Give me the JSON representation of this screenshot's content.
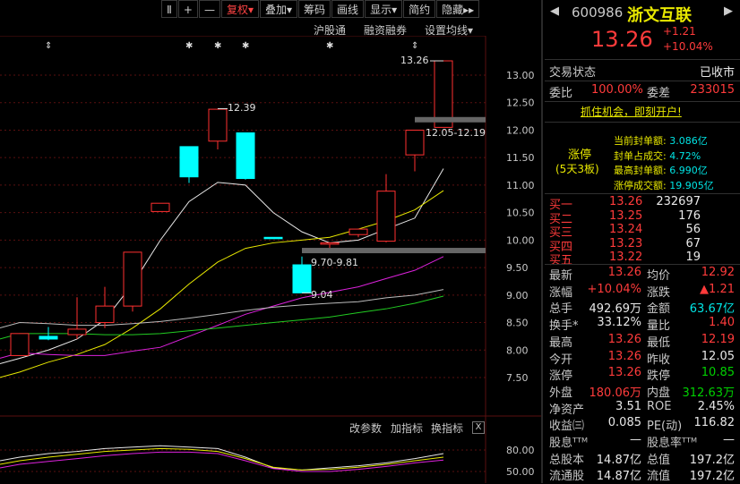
{
  "toolbar": {
    "items": [
      "Ⅱ",
      "+",
      "—",
      "复权▾",
      "叠加▾",
      "筹码",
      "画线",
      "显示▾",
      "简约",
      "隐藏▸▸"
    ]
  },
  "subbar": {
    "hk": "沪股通",
    "margin": "融资融券",
    "ma_settings": "设置均线▾"
  },
  "stock": {
    "code": "600986",
    "name": "浙文互联",
    "price": "13.26",
    "change": "+1.21",
    "pct": "+10.04%"
  },
  "trade_status": {
    "label": "交易状态",
    "value": "已收市"
  },
  "weibi": {
    "label": "委比",
    "value": "100.00%",
    "label2": "委差",
    "value2": "233015"
  },
  "banner": "抓住机会，即刻开户!",
  "limit_up": {
    "tag": "涨停",
    "sub": "(5天3板)",
    "rows": [
      {
        "label": "当前封单额:",
        "value": "3.086亿"
      },
      {
        "label": "封单占成交:",
        "value": "4.72%"
      },
      {
        "label": "最高封单额:",
        "value": "6.990亿"
      },
      {
        "label": "涨停成交额:",
        "value": "19.905亿"
      }
    ]
  },
  "order_book": [
    {
      "label": "买一",
      "price": "13.26",
      "vol": "232697"
    },
    {
      "label": "买二",
      "price": "13.25",
      "vol": "176"
    },
    {
      "label": "买三",
      "price": "13.24",
      "vol": "56"
    },
    {
      "label": "买四",
      "price": "13.23",
      "vol": "67"
    },
    {
      "label": "买五",
      "price": "13.22",
      "vol": "19"
    }
  ],
  "quote": [
    {
      "l1": "最新",
      "v1": "13.26",
      "c1": "red",
      "l2": "均价",
      "v2": "12.92",
      "c2": "red"
    },
    {
      "l1": "涨幅",
      "v1": "+10.04%",
      "c1": "red",
      "l2": "涨跌",
      "v2": "▲1.21",
      "c2": "red"
    },
    {
      "l1": "总手",
      "v1": "492.69万",
      "c1": "white",
      "l2": "金额",
      "v2": "63.67亿",
      "c2": "cyan"
    },
    {
      "l1": "换手*",
      "v1": "33.12%",
      "c1": "white",
      "l2": "量比",
      "v2": "1.40",
      "c2": "red"
    },
    {
      "l1": "最高",
      "v1": "13.26",
      "c1": "red",
      "l2": "最低",
      "v2": "12.19",
      "c2": "red"
    },
    {
      "l1": "今开",
      "v1": "13.26",
      "c1": "red",
      "l2": "昨收",
      "v2": "12.05",
      "c2": "white"
    },
    {
      "l1": "涨停",
      "v1": "13.26",
      "c1": "red",
      "l2": "跌停",
      "v2": "10.85",
      "c2": "green"
    },
    {
      "l1": "外盘",
      "v1": "180.06万",
      "c1": "red",
      "l2": "内盘",
      "v2": "312.63万",
      "c2": "green"
    },
    {
      "l1": "净资产",
      "v1": "3.51",
      "c1": "white",
      "l2": "ROE",
      "v2": "2.45%",
      "c2": "white"
    },
    {
      "l1": "收益㈢",
      "v1": "0.085",
      "c1": "white",
      "l2": "PE(动)",
      "v2": "116.82",
      "c2": "white"
    },
    {
      "l1": "股息ᵀᵀᴹ",
      "v1": "—",
      "c1": "white",
      "l2": "股息率ᵀᵀᴹ",
      "v2": "—",
      "c2": "white"
    },
    {
      "l1": "总股本",
      "v1": "14.87亿",
      "c1": "white",
      "l2": "总值",
      "v2": "197.2亿",
      "c2": "white"
    },
    {
      "l1": "流通股",
      "v1": "14.87亿",
      "c1": "white",
      "l2": "流值",
      "v2": "197.2亿",
      "c2": "white"
    }
  ],
  "chart_labels": {
    "high_marker": "13.26",
    "peak_label": "12.39",
    "gap_label": "12.05-12.19",
    "gap2_label": "9.70-9.81",
    "low_label": "9.04",
    "ind_params": "改参数",
    "ind_add": "加指标",
    "ind_switch": "换指标",
    "close_x": "X"
  },
  "chart_data": {
    "type": "candlestick",
    "y_ticks": [
      "13.00",
      "12.50",
      "12.00",
      "11.50",
      "11.00",
      "10.50",
      "10.00",
      "9.50",
      "9.00",
      "8.50",
      "8.00",
      "7.50"
    ],
    "ylim": [
      7.2,
      13.4
    ],
    "candles": [
      {
        "o": 7.9,
        "c": 8.3,
        "h": 8.3,
        "l": 7.9,
        "up": true
      },
      {
        "o": 8.25,
        "c": 8.2,
        "h": 8.42,
        "l": 8.18,
        "up": false
      },
      {
        "o": 8.28,
        "c": 8.38,
        "h": 8.96,
        "l": 8.2,
        "up": true
      },
      {
        "o": 8.5,
        "c": 8.8,
        "h": 9.15,
        "l": 8.4,
        "up": true
      },
      {
        "o": 8.8,
        "c": 9.78,
        "h": 9.78,
        "l": 8.7,
        "up": true
      },
      {
        "o": 10.52,
        "c": 10.67,
        "h": 10.67,
        "l": 10.52,
        "up": true
      },
      {
        "o": 11.7,
        "c": 11.15,
        "h": 11.7,
        "l": 11.04,
        "up": false
      },
      {
        "o": 11.8,
        "c": 12.38,
        "h": 12.39,
        "l": 11.65,
        "up": true
      },
      {
        "o": 11.95,
        "c": 11.12,
        "h": 11.95,
        "l": 11.1,
        "up": false
      },
      {
        "o": 10.05,
        "c": 10.05,
        "h": 10.05,
        "l": 10.05,
        "up": false
      },
      {
        "o": 9.55,
        "c": 9.04,
        "h": 9.7,
        "l": 9.04,
        "up": false
      },
      {
        "o": 9.95,
        "c": 9.95,
        "h": 9.95,
        "l": 9.81,
        "up": true
      },
      {
        "o": 10.1,
        "c": 10.2,
        "h": 10.2,
        "l": 10.05,
        "up": true
      },
      {
        "o": 9.98,
        "c": 10.89,
        "h": 11.2,
        "l": 9.96,
        "up": true
      },
      {
        "o": 11.55,
        "c": 12.0,
        "h": 12.0,
        "l": 11.25,
        "up": true
      },
      {
        "o": 12.05,
        "c": 13.26,
        "h": 13.26,
        "l": 12.05,
        "up": true
      }
    ],
    "ma_lines": [
      {
        "name": "white",
        "color": "#e8e8e8",
        "values": [
          7.85,
          8.0,
          8.2,
          8.55,
          9.2,
          10.0,
          10.7,
          11.05,
          11.0,
          10.5,
          10.15,
          9.95,
          10.0,
          10.2,
          10.4,
          11.3
        ]
      },
      {
        "name": "yellow",
        "color": "#e8e800",
        "values": [
          7.6,
          7.78,
          7.92,
          8.1,
          8.4,
          8.75,
          9.2,
          9.6,
          9.85,
          9.95,
          10.0,
          10.05,
          10.2,
          10.35,
          10.55,
          10.9
        ]
      },
      {
        "name": "magenta",
        "color": "#dd22dd",
        "values": [
          7.95,
          7.92,
          7.9,
          7.9,
          7.98,
          8.05,
          8.25,
          8.45,
          8.65,
          8.8,
          8.95,
          9.05,
          9.15,
          9.3,
          9.45,
          9.7
        ]
      },
      {
        "name": "gray",
        "color": "#bbbbbb",
        "values": [
          8.5,
          8.48,
          8.45,
          8.45,
          8.48,
          8.52,
          8.58,
          8.65,
          8.72,
          8.78,
          8.82,
          8.85,
          8.88,
          8.95,
          9.0,
          9.1
        ]
      },
      {
        "name": "green",
        "color": "#22cc22",
        "values": [
          8.3,
          8.3,
          8.3,
          8.28,
          8.28,
          8.3,
          8.35,
          8.4,
          8.45,
          8.5,
          8.55,
          8.6,
          8.68,
          8.75,
          8.85,
          8.98
        ]
      }
    ],
    "indicator": {
      "y_ticks": [
        "80.00",
        "50.00"
      ],
      "lines": [
        {
          "color": "#e8e8e8",
          "values": [
            70,
            75,
            78,
            82,
            84,
            86,
            84,
            82,
            70,
            55,
            52,
            55,
            58,
            62,
            68,
            75
          ]
        },
        {
          "color": "#e8e800",
          "values": [
            65,
            70,
            74,
            78,
            80,
            82,
            81,
            78,
            68,
            56,
            52,
            53,
            56,
            60,
            65,
            70
          ]
        },
        {
          "color": "#dd22dd",
          "values": [
            60,
            64,
            68,
            72,
            75,
            77,
            77,
            75,
            65,
            54,
            50,
            50,
            53,
            57,
            62,
            66
          ]
        }
      ]
    }
  }
}
